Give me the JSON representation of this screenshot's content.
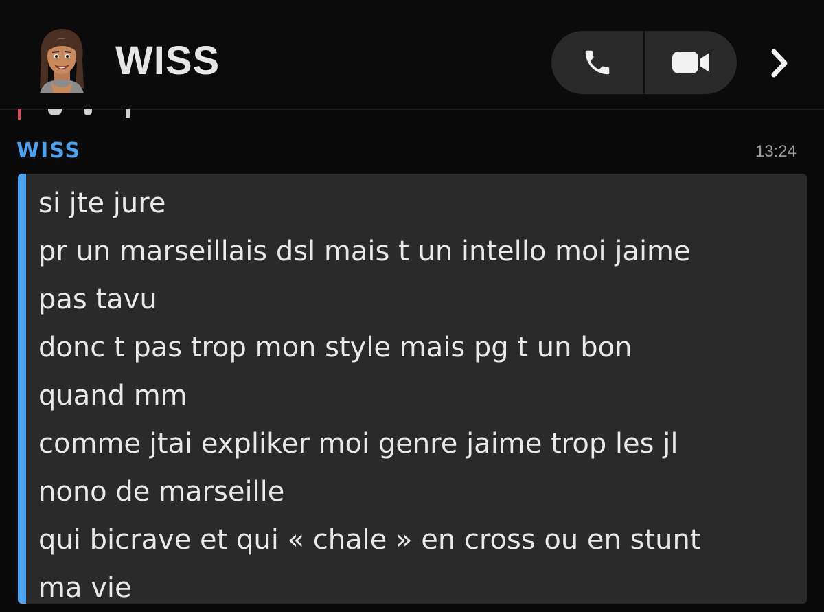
{
  "header": {
    "contact_name": "WISS",
    "avatar_icon": "bitmoji-avatar-icon",
    "call_icon": "phone-icon",
    "video_icon": "video-camera-icon",
    "more_icon": "chevron-right-icon",
    "pill_color": "#2a2a2a"
  },
  "message": {
    "sender": "WISS",
    "sender_color": "#4aa3f0",
    "time": "13:24",
    "lines": [
      "si jte jure",
      "pr un marseillais dsl mais t un intello moi jaime",
      "pas tavu",
      "donc t pas trop mon style mais pg t un bon",
      "quand mm",
      "comme jtai expliker moi genre jaime trop les jl",
      "nono de marseille",
      "qui bicrave et qui « chale » en cross ou en stunt",
      "ma vie"
    ]
  },
  "previous_message": {
    "accent_color": "#e0485a"
  }
}
